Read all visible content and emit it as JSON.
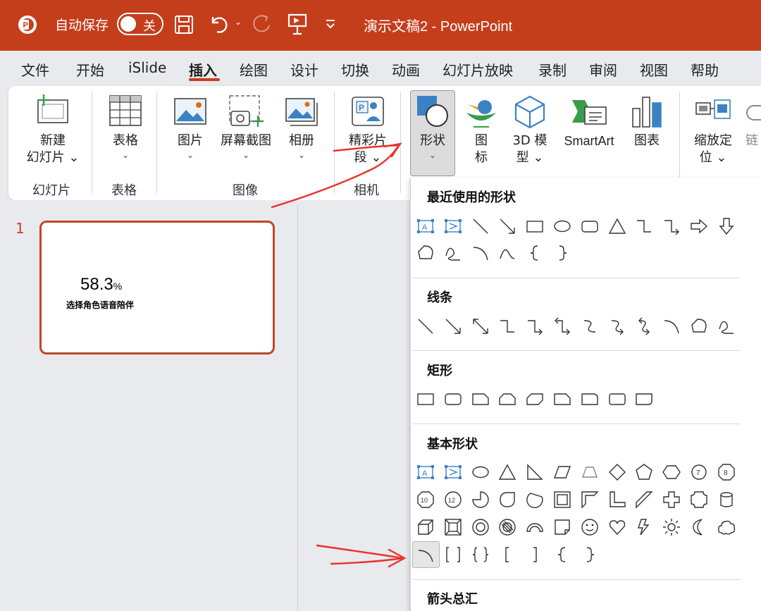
{
  "titlebar": {
    "autosave_label": "自动保存",
    "autosave_state": "关",
    "doc_title": "演示文稿2  -  PowerPoint",
    "bg_color": "#c43e1c"
  },
  "tabs": [
    {
      "label": "文件"
    },
    {
      "label": "开始"
    },
    {
      "label": "iSlide"
    },
    {
      "label": "插入",
      "active": true
    },
    {
      "label": "绘图"
    },
    {
      "label": "设计"
    },
    {
      "label": "切换"
    },
    {
      "label": "动画"
    },
    {
      "label": "幻灯片放映"
    },
    {
      "label": "录制"
    },
    {
      "label": "审阅"
    },
    {
      "label": "视图"
    },
    {
      "label": "帮助"
    }
  ],
  "ribbon": {
    "new_slide": {
      "line1": "新建",
      "line2": "幻灯片"
    },
    "table": {
      "label": "表格"
    },
    "picture": {
      "label": "图片"
    },
    "screenshot": {
      "label": "屏幕截图"
    },
    "album": {
      "label": "相册"
    },
    "clip": {
      "line1": "精彩片",
      "line2": "段"
    },
    "shapes": {
      "label": "形状"
    },
    "icons": {
      "line1": "图",
      "line2": "标"
    },
    "model3d": {
      "line1": "3D 模",
      "line2": "型"
    },
    "smartart": {
      "label": "SmartArt"
    },
    "chart": {
      "label": "图表"
    },
    "zoom": {
      "line1": "缩放定",
      "line2": "位"
    },
    "link": {
      "label": "链"
    },
    "groups": {
      "slides": "幻灯片",
      "tables": "表格",
      "images": "图像",
      "camera": "相机"
    }
  },
  "slide_panel": {
    "slide_number": "1",
    "thumb_value": "58.3",
    "thumb_unit": "%",
    "thumb_caption": "选择角色语音陪伴"
  },
  "gallery": {
    "recent": "最近使用的形状",
    "lines": "线条",
    "rectangles": "矩形",
    "basic": "基本形状",
    "arrows": "箭头总汇"
  },
  "colors": {
    "accent": "#c43e1c",
    "annotation_arrow": "#e8322c",
    "shape_icon_blue": "#3b82c4"
  }
}
